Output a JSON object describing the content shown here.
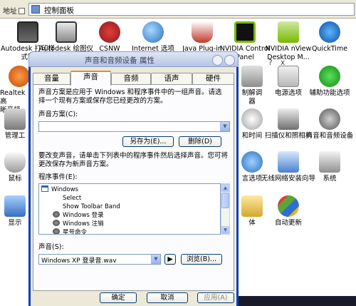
{
  "address_bar": {
    "label": "地址",
    "value": "控制面板"
  },
  "control_panel": {
    "items": [
      {
        "label": "Autodesk 打印样式管",
        "icon": "autodesk-print-icon"
      },
      {
        "label": "Autodesk 绘图仪管理器",
        "icon": "autodesk-plotter-icon"
      },
      {
        "label": "CSNW",
        "icon": "network-icon"
      },
      {
        "label": "Internet 选项",
        "icon": "internet-globe-icon"
      },
      {
        "label": "Java Plug-in 1.3.1_09",
        "icon": "java-cup-icon"
      },
      {
        "label": "NVIDIA Control Panel",
        "icon": "nvidia-icon"
      },
      {
        "label": "NVIDIA nView Desktop M...",
        "icon": "nvidia-nview-icon"
      },
      {
        "label": "QuickTime",
        "icon": "quicktime-icon"
      },
      {
        "label": "Realtek高清晰音频配置",
        "icon": "speaker-icon"
      },
      {
        "label": "调制解调器",
        "icon": "phone-modem-icon"
      },
      {
        "label": "电源选项",
        "icon": "power-icon"
      },
      {
        "label": "辅助功能选项",
        "icon": "accessibility-icon"
      },
      {
        "label": "管理工具",
        "icon": "admin-tools-icon"
      },
      {
        "label": "日期和时间",
        "icon": "clock-icon"
      },
      {
        "label": "扫描仪和照相机",
        "icon": "scanner-icon"
      },
      {
        "label": "声音和音频设备",
        "icon": "sound-icon"
      },
      {
        "label": "鼠标",
        "icon": "mouse-icon"
      },
      {
        "label": "区域和语言选项",
        "icon": "region-icon"
      },
      {
        "label": "无线网络安装向导",
        "icon": "wireless-icon"
      },
      {
        "label": "系统",
        "icon": "system-icon"
      },
      {
        "label": "显示",
        "icon": "display-icon"
      },
      {
        "label": "字体",
        "icon": "font-icon"
      },
      {
        "label": "自动更新",
        "icon": "update-shield-icon"
      }
    ],
    "partial_labels": {
      "realtek_a": "Realtek高",
      "realtek_b": "晰音频",
      "admin": "管理工",
      "mouse": "鼠标",
      "display": "显示",
      "modem_a": "制解调",
      "modem_b": "器",
      "datetime": "和时间",
      "region": "言选项",
      "font": "体"
    }
  },
  "dialog": {
    "title": "声音和音频设备 属性",
    "help_label": "?",
    "close_label": "x",
    "tabs": [
      "音量",
      "声音",
      "音频",
      "语声",
      "硬件"
    ],
    "active_tab": "声音",
    "scheme_intro": "声音方案是应用于 Windows 和程序事件中的一组声音。请选择一个现有方案或保存您已经更改的方案。",
    "scheme_label": "声音方案(C):",
    "scheme_value": "",
    "save_as_label": "另存为(E)...",
    "delete_label": "删除(D)",
    "events_intro": "要改变声音，请单击下列表中的程序事件然后选择声音。您可将更改保存为新声音方案。",
    "events_label": "程序事件(E):",
    "events": [
      {
        "label": "Windows",
        "indent": 0,
        "icon": "window-icon"
      },
      {
        "label": "Select",
        "indent": 1,
        "icon": ""
      },
      {
        "label": "Show Toolbar Band",
        "indent": 1,
        "icon": ""
      },
      {
        "label": "Windows 登录",
        "indent": 1,
        "icon": "speaker-icon"
      },
      {
        "label": "Windows 注销",
        "indent": 1,
        "icon": "speaker-icon"
      },
      {
        "label": "星号命令",
        "indent": 1,
        "icon": "speaker-icon"
      }
    ],
    "sound_label": "声音(S):",
    "sound_value": "Windows XP 登录音.wav",
    "play_label": "▶",
    "browse_label": "浏览(B)...",
    "ok_label": "确定",
    "cancel_label": "取消",
    "apply_label": "应用(A)"
  }
}
